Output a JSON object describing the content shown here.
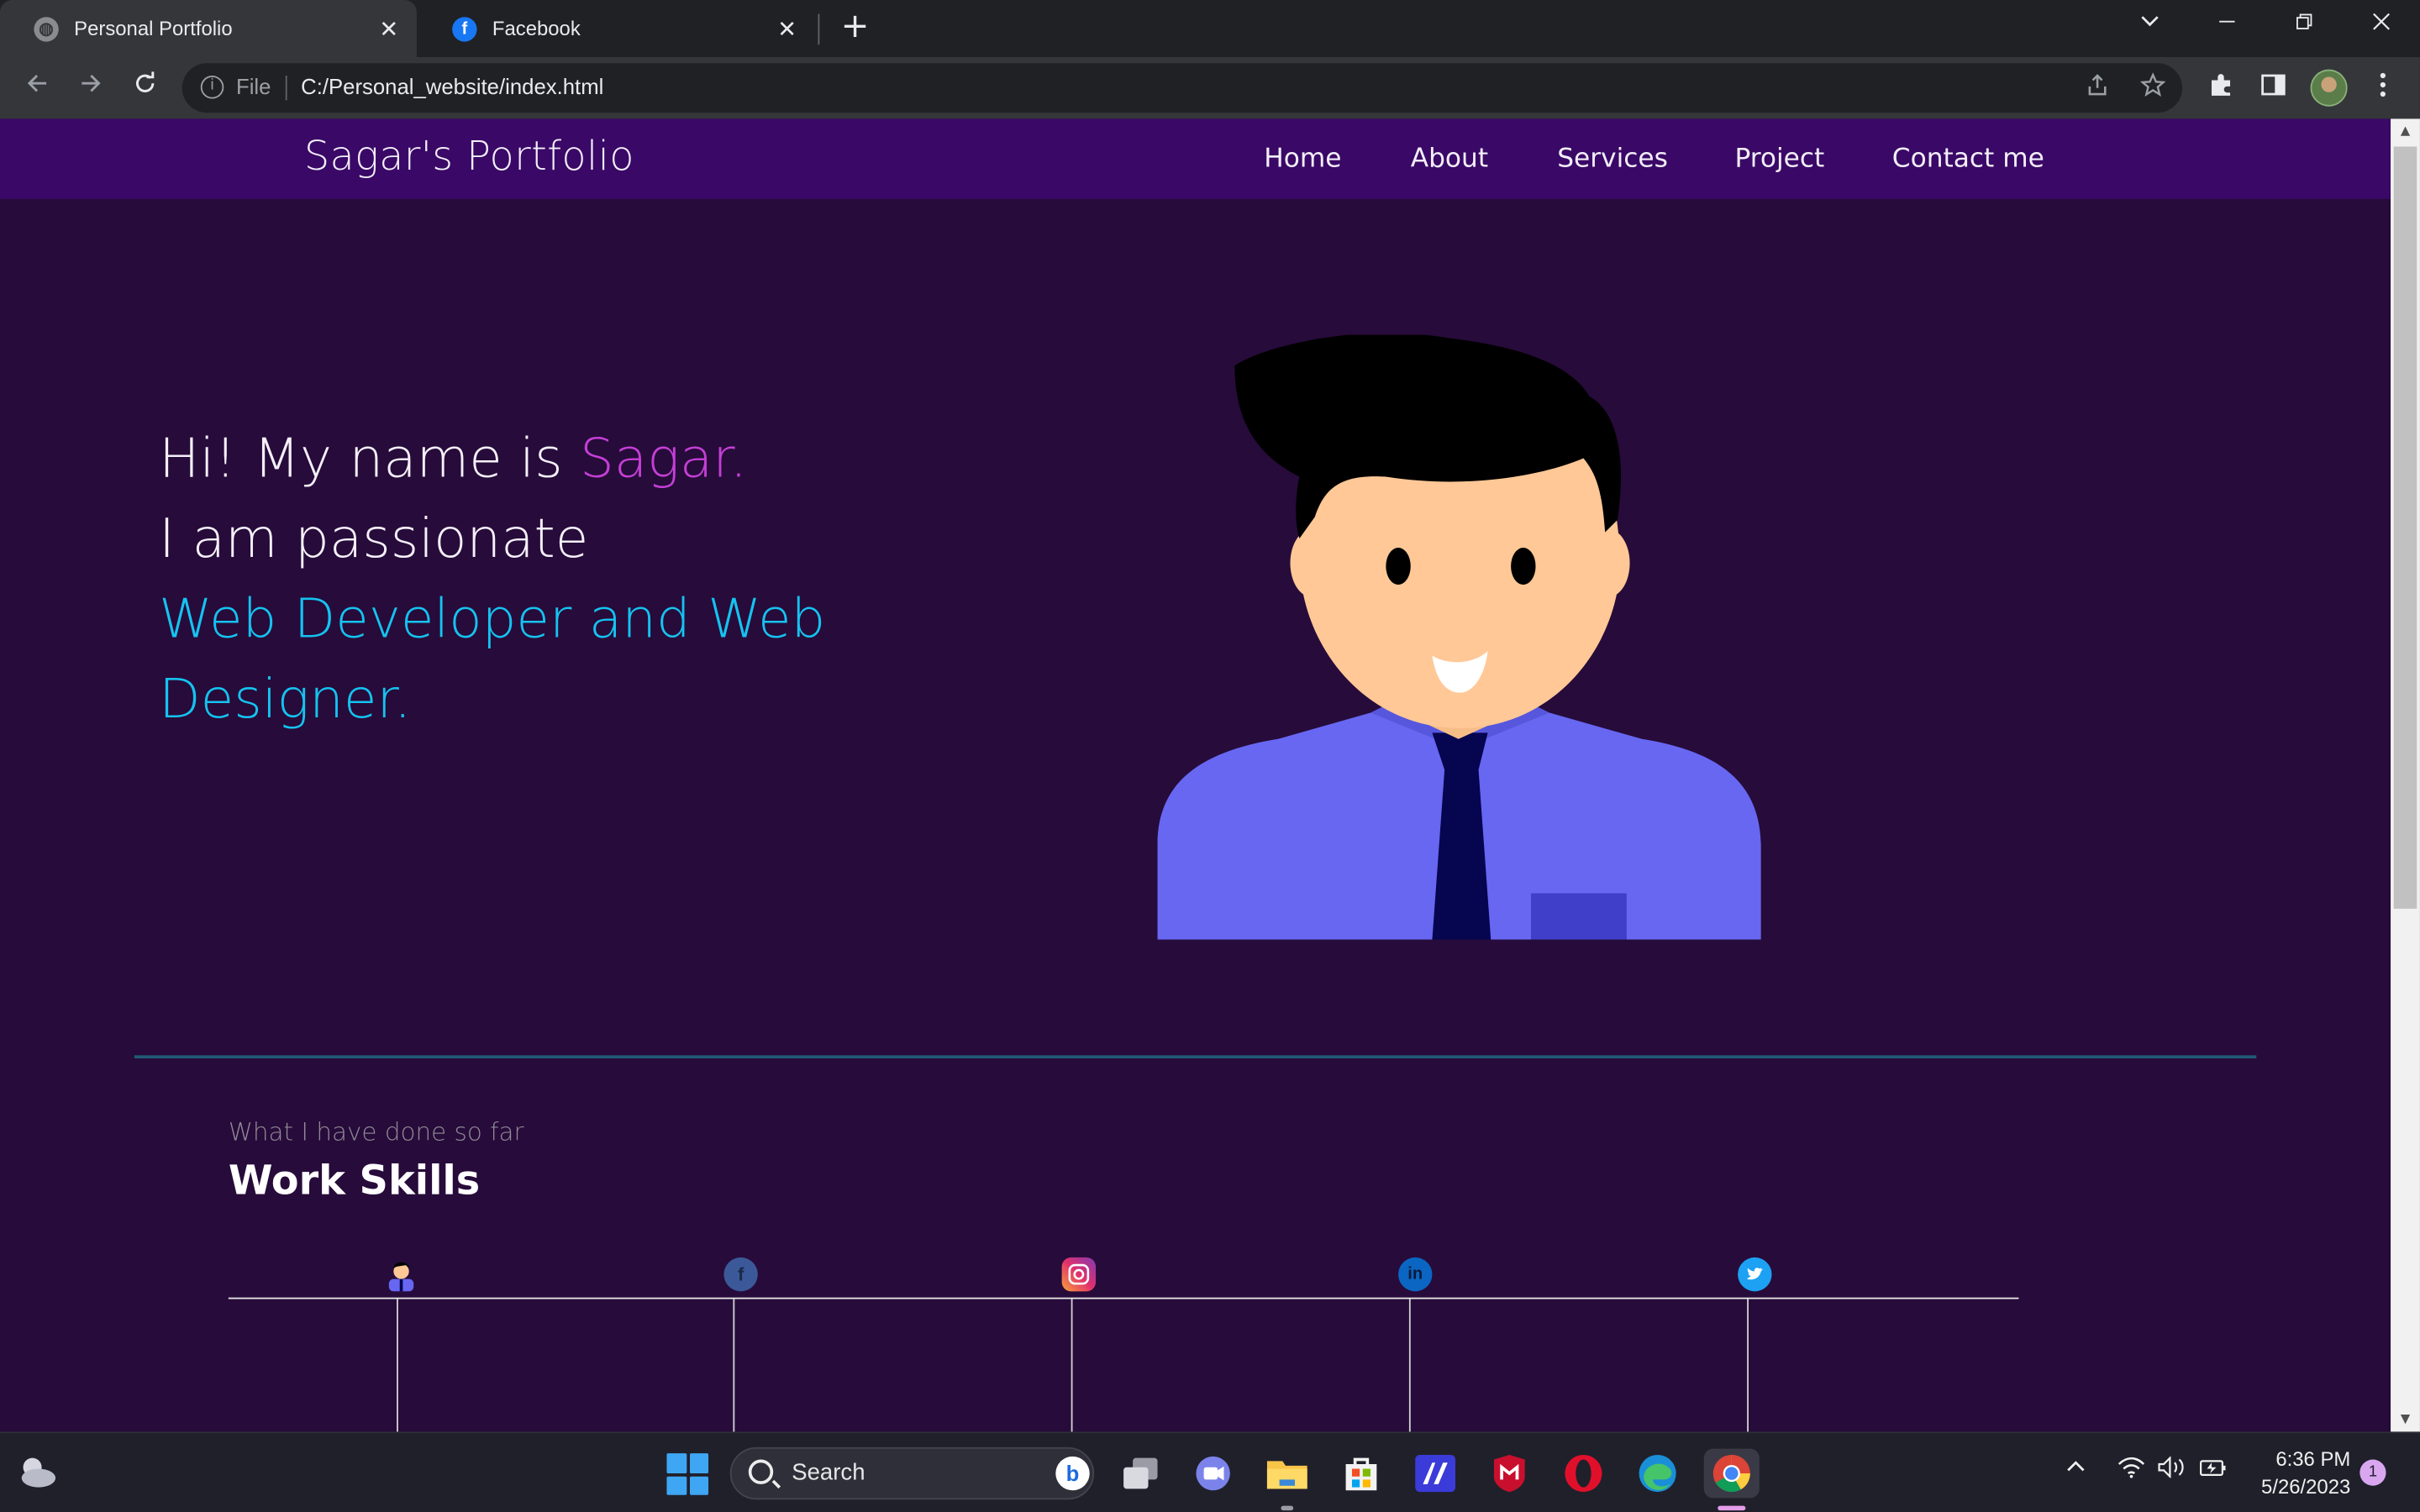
{
  "browser": {
    "tabs": [
      {
        "title": "Personal Portfolio",
        "icon": "globe-icon",
        "active": true
      },
      {
        "title": "Facebook",
        "icon": "facebook-icon",
        "active": false
      }
    ],
    "new_tab_symbol": "+",
    "close_symbol": "✕",
    "address": {
      "scheme_label": "File",
      "url": "C:/Personal_website/index.html"
    }
  },
  "site": {
    "brand": "Sagar's Portfolio",
    "nav": [
      "Home",
      "About",
      "Services",
      "Project",
      "Contact me"
    ],
    "hero": {
      "line1_prefix": "Hi! My name is ",
      "line1_name": "Sagar.",
      "line2": "I am passionate",
      "line3": "Web Developer and Web",
      "line4": "Designer.",
      "name_color": "#c43fd6",
      "role_color": "#15c3f0"
    },
    "skills": {
      "eyebrow": "What I have done so far",
      "title": "Work Skills",
      "timeline_icons": [
        "person-icon",
        "facebook-icon",
        "instagram-icon",
        "linkedin-icon",
        "twitter-icon"
      ]
    },
    "colors": {
      "nav_bg": "#3a0866",
      "page_bg": "#270b3a",
      "divider": "#1f5a74"
    }
  },
  "taskbar": {
    "search_label": "Search",
    "apps": [
      "task-view-icon",
      "teams-chat-icon",
      "file-explorer-icon",
      "microsoft-store-icon",
      "media-app-icon",
      "mcafee-icon",
      "opera-icon",
      "edge-icon",
      "chrome-icon"
    ],
    "time": "6:36 PM",
    "date": "5/26/2023",
    "notification_count": "1"
  }
}
